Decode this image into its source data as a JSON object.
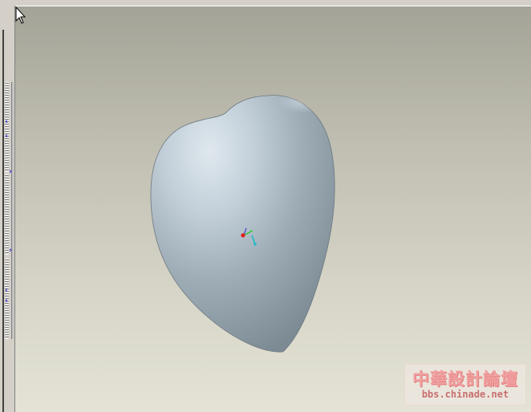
{
  "side_panel": {
    "arrows": [
      {
        "dir": "left",
        "glyph": "‹"
      },
      {
        "dir": "left",
        "glyph": "‹"
      },
      {
        "dir": "right",
        "glyph": "›"
      },
      {
        "dir": "right",
        "glyph": "›"
      },
      {
        "dir": "left",
        "glyph": "‹"
      },
      {
        "dir": "left",
        "glyph": "‹"
      }
    ]
  },
  "viewport": {
    "model_color": "#b4c2cc",
    "background_top": "#a4a397",
    "background_bottom": "#e4e3d6",
    "model": "heart-shaped solid"
  },
  "watermark": {
    "title": "中華設計論壇",
    "url": "bbs.chinade.net"
  },
  "icons": {
    "cursor": "arrow-cursor-icon",
    "csys": "coordinate-system-icon"
  }
}
